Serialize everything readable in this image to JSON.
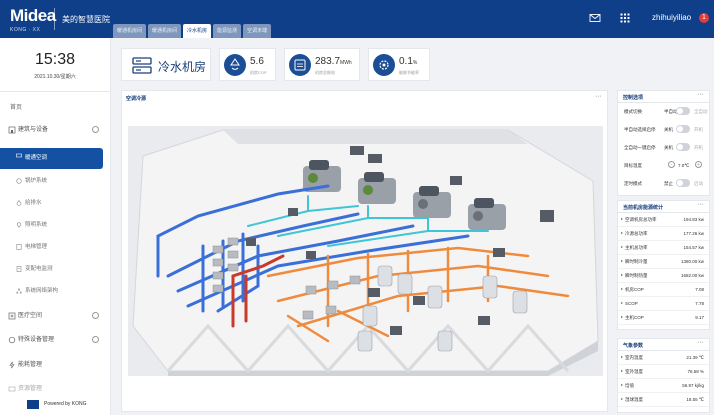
{
  "header": {
    "logo": "Midea",
    "logo_sub": "KONG · XX",
    "hospital": "美的智慧医院",
    "tabs": [
      "暖通机房间",
      "暖通机房间",
      "冷水机房",
      "能源监测",
      "空调末端"
    ],
    "active_tab_index": 2,
    "user": "zhihuiyiliao",
    "badge": "1"
  },
  "sidebar": {
    "time": "15:38",
    "date": "2021.10.30/星期六",
    "home": "首页",
    "sections": [
      {
        "label": "建筑与设备",
        "icon": "building-icon"
      },
      {
        "label": "医疗空间",
        "icon": "medical-space-icon"
      },
      {
        "label": "特殊设备管理",
        "icon": "special-device-icon"
      },
      {
        "label": "能耗管理",
        "icon": "energy-icon"
      },
      {
        "label": "资源管理",
        "icon": "resource-icon"
      }
    ],
    "sub_items": [
      {
        "label": "暖通空调",
        "icon": "hvac-icon"
      },
      {
        "label": "锅炉系统",
        "icon": "boiler-icon"
      },
      {
        "label": "给排水",
        "icon": "water-icon"
      },
      {
        "label": "照明系统",
        "icon": "light-icon"
      },
      {
        "label": "电梯管理",
        "icon": "elevator-icon"
      },
      {
        "label": "变配电监测",
        "icon": "power-icon"
      },
      {
        "label": "系统网络架构",
        "icon": "network-icon"
      }
    ],
    "active_sub_index": 0,
    "footer": "Powered by KONG"
  },
  "kpis": {
    "title": "冷水机房",
    "items": [
      {
        "value": "5.6",
        "unit": "",
        "caption": "机房COP",
        "icon": "recycle-icon"
      },
      {
        "value": "283.7",
        "unit": "MWh",
        "caption": "机房总耗电",
        "icon": "meter-icon"
      },
      {
        "value": "0.1",
        "unit": "%",
        "caption": "能耗节能率",
        "icon": "gear-icon"
      }
    ]
  },
  "scene_panel": {
    "title": "空调冷源",
    "more": "···"
  },
  "control_panel": {
    "title": "控制选项",
    "more": "···",
    "rows": [
      {
        "label": "模式切换",
        "left": "半自动",
        "right": "全自动"
      },
      {
        "label": "半自动选择启停",
        "left": "关机",
        "right": "开机"
      },
      {
        "label": "全自动一键启停",
        "left": "关机",
        "right": "开机"
      },
      {
        "label": "目标温度",
        "value": "7.0℃",
        "minus": "-",
        "plus": "+"
      },
      {
        "label": "定时模式",
        "left": "禁止",
        "right": "启动"
      }
    ]
  },
  "stats_panel": {
    "title": "当前机房能源统计",
    "more": "···",
    "rows": [
      {
        "label": "空调机房总功率",
        "value": "194.83 kw"
      },
      {
        "label": "冷源总功率",
        "value": "177.26 kw"
      },
      {
        "label": "主机总功率",
        "value": "154.57 kw"
      },
      {
        "label": "瞬时制冷量",
        "value": "1380.00 kw"
      },
      {
        "label": "瞬时制热量",
        "value": "1682.00 kw"
      },
      {
        "label": "机房COP",
        "value": "7.08"
      },
      {
        "label": "SCOP",
        "value": "7.78"
      },
      {
        "label": "主机COP",
        "value": "9.17"
      }
    ]
  },
  "weather_panel": {
    "title": "气象参数",
    "more": "···",
    "rows": [
      {
        "label": "室内温度",
        "value": "21.39 ℃"
      },
      {
        "label": "室外温度",
        "value": "76.58 %"
      },
      {
        "label": "焓值",
        "value": "56.97 kj/kg"
      },
      {
        "label": "湿球温度",
        "value": "18.55 ℃"
      }
    ]
  },
  "colors": {
    "header_bg": "#0e3f88",
    "active_nav": "#1451a3",
    "pipe_blue": "#3a6fd8",
    "pipe_cyan": "#3ec5d6",
    "pipe_orange": "#f08a3c",
    "pipe_red": "#c83a2a"
  }
}
